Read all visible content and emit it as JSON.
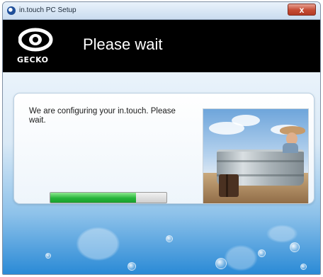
{
  "window": {
    "title": "in.touch PC Setup",
    "close_label": "x"
  },
  "header": {
    "brand": "GECKO",
    "title": "Please wait"
  },
  "main": {
    "message": "We are configuring your in.touch. Please wait.",
    "progress": 0.74
  },
  "colors": {
    "header_bg": "#000000",
    "progress_fill": "#26b43a",
    "close_button": "#c44a33"
  },
  "icons": {
    "app": "gecko-app-icon",
    "logo": "gecko-logo-icon",
    "close": "close-icon"
  }
}
